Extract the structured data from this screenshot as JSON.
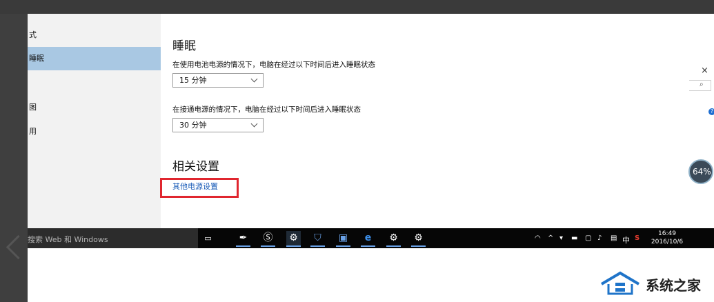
{
  "sidebar": {
    "items": [
      {
        "label": "式",
        "active": false
      },
      {
        "label": "睡眠",
        "active": true
      },
      {
        "label": "图",
        "active": false
      },
      {
        "label": "用",
        "active": false
      }
    ]
  },
  "sleep": {
    "title": "睡眠",
    "battery_label": "在使用电池电源的情况下，电脑在经过以下时间后进入睡眠状态",
    "battery_value": "15 分钟",
    "plugged_label": "在接通电源的情况下，电脑在经过以下时间后进入睡眠状态",
    "plugged_value": "30 分钟"
  },
  "related": {
    "title": "相关设置",
    "link": "其他电源设置"
  },
  "side_widget": {
    "close": "×",
    "help": "?",
    "gauge": "64%"
  },
  "taskbar": {
    "search_placeholder": "搜索 Web 和 Windows",
    "ime": "中",
    "time": "16:49",
    "date": "2016/10/6"
  },
  "watermark": {
    "text": "系统之家"
  },
  "colors": {
    "accent_selected": "#a9c8e3",
    "link": "#1a5cb8",
    "highlight_box": "#e0262f",
    "taskbar": "#060606"
  }
}
